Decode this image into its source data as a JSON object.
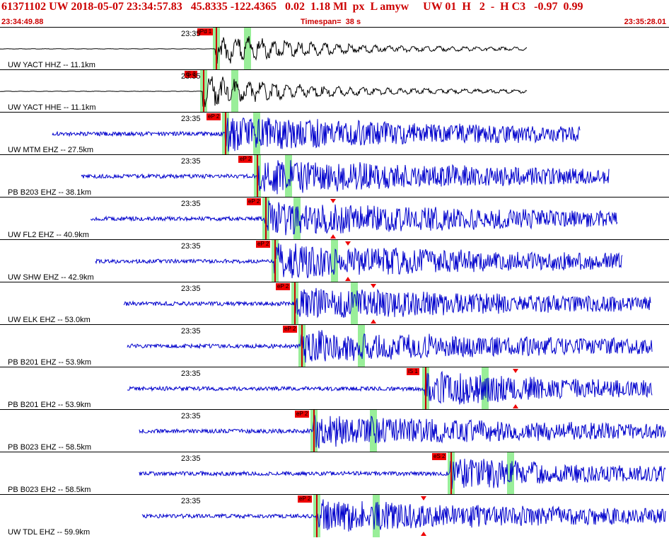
{
  "header": {
    "main": "61371102 UW 2018-05-07 23:34:57.83   45.8335 -122.4365   0.02  1.18 Ml  px  L amyw     UW 01  H   2  -  H C3   -0.97  0.99",
    "start_time": "23:34:49.88",
    "timespan": "Timespan=  38 s",
    "end_time": "23:35:28.01"
  },
  "colors": {
    "header": "#cc0000",
    "trace_near": "#000000",
    "trace_far": "#0000cc",
    "pick": "#e00000",
    "window": "#99ee99"
  },
  "traces": [
    {
      "id": "yact-hhz",
      "time_label": "23:35",
      "label": "UW YACT HHZ -- 11.1km",
      "pick_label": "iPd 1",
      "color": "#000000",
      "start": 0.0,
      "arrival": 0.322,
      "end": 0.787,
      "amp": 1.2,
      "peak": 0.2
    },
    {
      "id": "yact-hhe",
      "time_label": "23:35",
      "label": "UW YACT HHE -- 11.1km",
      "pick_label": "iS 2",
      "color": "#000000",
      "start": 0.0,
      "arrival": 0.303,
      "end": 0.787,
      "amp": 1.0,
      "peak": 0.2
    },
    {
      "id": "mtm-ehz",
      "time_label": "23:35",
      "label": "UW MTM EHZ -- 27.5km",
      "pick_label": "eP 2",
      "color": "#0000cc",
      "start": 0.078,
      "arrival": 0.336,
      "end": 0.867,
      "amp": 1.0,
      "peak": 0.45
    },
    {
      "id": "b203-ehz",
      "time_label": "23:35",
      "label": "PB B203 EHZ -- 38.1km",
      "pick_label": "eP 2",
      "color": "#0000cc",
      "start": 0.122,
      "arrival": 0.384,
      "end": 0.91,
      "amp": 1.0,
      "peak": 0.55
    },
    {
      "id": "fl2-ehz",
      "time_label": "23:35",
      "label": "UW FL2 EHZ -- 40.9km",
      "pick_label": "eP 2",
      "color": "#0000cc",
      "start": 0.135,
      "arrival": 0.396,
      "end": 0.923,
      "amp": 1.0,
      "peak": 0.4
    },
    {
      "id": "shw-ehz",
      "time_label": "23:35",
      "label": "UW SHW EHZ -- 42.9km",
      "pick_label": "eP 2",
      "color": "#0000cc",
      "start": 0.143,
      "arrival": 0.41,
      "end": 0.93,
      "amp": 1.0,
      "peak": 0.1
    },
    {
      "id": "elk-ehz",
      "time_label": "23:35",
      "label": "UW ELK EHZ -- 53.0km",
      "pick_label": "eP 2",
      "color": "#0000cc",
      "start": 0.185,
      "arrival": 0.44,
      "end": 0.972,
      "amp": 0.9,
      "peak": 0.6
    },
    {
      "id": "b201-ehz",
      "time_label": "23:35",
      "label": "PB B201 EHZ -- 53.9km",
      "pick_label": "eP 2",
      "color": "#0000cc",
      "start": 0.19,
      "arrival": 0.45,
      "end": 0.975,
      "amp": 0.9,
      "peak": 0.5
    },
    {
      "id": "b201-eh2",
      "time_label": "23:35",
      "label": "PB B201 EH2 -- 53.9km",
      "pick_label": "iS 1",
      "color": "#0000cc",
      "start": 0.19,
      "arrival": 0.635,
      "end": 0.975,
      "amp": 1.0,
      "peak": 0.15
    },
    {
      "id": "b023-ehz",
      "time_label": "23:35",
      "label": "PB B023 EHZ -- 58.5km",
      "pick_label": "eP 2",
      "color": "#0000cc",
      "start": 0.208,
      "arrival": 0.468,
      "end": 0.995,
      "amp": 0.9,
      "peak": 0.05
    },
    {
      "id": "b023-eh2",
      "time_label": "23:35",
      "label": "PB B023 EH2 -- 58.5km",
      "pick_label": "eS 2",
      "color": "#0000cc",
      "start": 0.208,
      "arrival": 0.673,
      "end": 0.995,
      "amp": 0.9,
      "peak": 0.1
    },
    {
      "id": "tdl-ehz",
      "time_label": "23:35",
      "label": "UW TDL EHZ -- 59.9km",
      "pick_label": "eP 2",
      "color": "#0000cc",
      "start": 0.212,
      "arrival": 0.472,
      "end": 0.995,
      "amp": 0.9,
      "peak": 0.3
    }
  ]
}
